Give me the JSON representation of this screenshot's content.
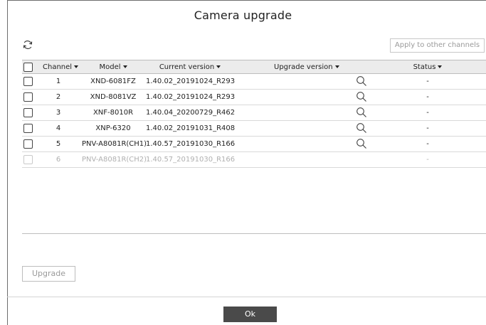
{
  "dialog": {
    "title": "Camera upgrade",
    "apply_button": "Apply to other channels",
    "upgrade_button": "Upgrade",
    "ok_button": "Ok"
  },
  "table": {
    "headers": {
      "channel": "Channel",
      "model": "Model",
      "current_version": "Current version",
      "upgrade_version": "Upgrade version",
      "status": "Status"
    },
    "rows": [
      {
        "channel": "1",
        "model": "XND-6081FZ",
        "current_version": "1.40.02_20191024_R293",
        "upgrade_version": "",
        "status": "-",
        "enabled": true,
        "has_search": true
      },
      {
        "channel": "2",
        "model": "XND-8081VZ",
        "current_version": "1.40.02_20191024_R293",
        "upgrade_version": "",
        "status": "-",
        "enabled": true,
        "has_search": true
      },
      {
        "channel": "3",
        "model": "XNF-8010R",
        "current_version": "1.40.04_20200729_R462",
        "upgrade_version": "",
        "status": "-",
        "enabled": true,
        "has_search": true
      },
      {
        "channel": "4",
        "model": "XNP-6320",
        "current_version": "1.40.02_20191031_R408",
        "upgrade_version": "",
        "status": "-",
        "enabled": true,
        "has_search": true
      },
      {
        "channel": "5",
        "model": "PNV-A8081R(CH1)",
        "current_version": "1.40.57_20191030_R166",
        "upgrade_version": "",
        "status": "-",
        "enabled": true,
        "has_search": true
      },
      {
        "channel": "6",
        "model": "PNV-A8081R(CH2)",
        "current_version": "1.40.57_20191030_R166",
        "upgrade_version": "",
        "status": "-",
        "enabled": false,
        "has_search": false
      }
    ]
  },
  "icons": {
    "refresh": "refresh-icon",
    "search": "search-icon",
    "sort": "caret-down-icon"
  }
}
